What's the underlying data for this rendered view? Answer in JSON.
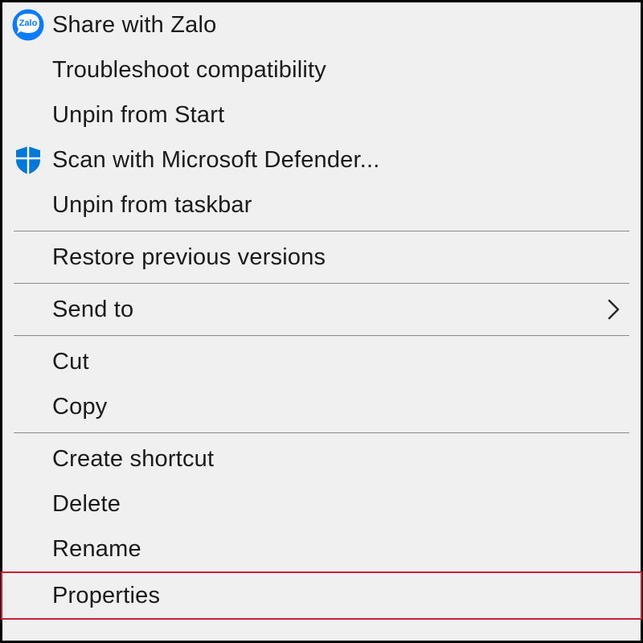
{
  "menu": {
    "items": [
      {
        "label": "Share with Zalo",
        "icon": "zalo"
      },
      {
        "label": "Troubleshoot compatibility",
        "icon": null
      },
      {
        "label": "Unpin from Start",
        "icon": null
      },
      {
        "label": "Scan with Microsoft Defender...",
        "icon": "defender"
      },
      {
        "label": "Unpin from taskbar",
        "icon": null
      }
    ],
    "restore_label": "Restore previous versions",
    "sendto_label": "Send to",
    "cut_label": "Cut",
    "copy_label": "Copy",
    "create_shortcut_label": "Create shortcut",
    "delete_label": "Delete",
    "rename_label": "Rename",
    "properties_label": "Properties"
  },
  "colors": {
    "highlight_border": "#c9203a",
    "defender_blue": "#0078d7"
  }
}
